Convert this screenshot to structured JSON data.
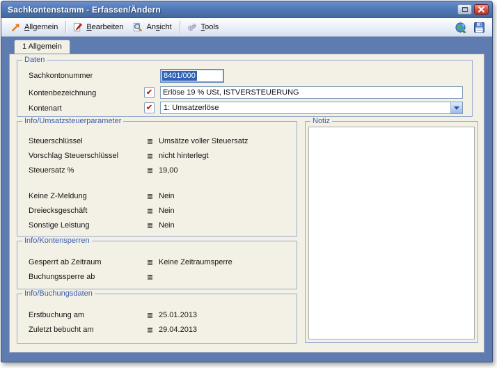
{
  "window": {
    "title": "Sachkontenstamm - Erfassen/Ändern",
    "controls": {
      "restore_icon": "restore-window",
      "close_icon": "close-window"
    }
  },
  "toolbar": {
    "menus": [
      {
        "icon": "arrow-up-right",
        "pre": "",
        "hotkey": "A",
        "post": "llgemein"
      },
      {
        "icon": "edit-page",
        "pre": "",
        "hotkey": "B",
        "post": "earbeiten"
      },
      {
        "icon": "magnifier-page",
        "pre": "An",
        "hotkey": "s",
        "post": "icht"
      },
      {
        "icon": "gears",
        "pre": "",
        "hotkey": "T",
        "post": "ools"
      }
    ],
    "right_icons": [
      "globe",
      "save"
    ]
  },
  "tab": {
    "label": "1 Allgemein"
  },
  "groups": {
    "daten": {
      "title": "Daten",
      "sachkontonummer": {
        "label": "Sachkontonummer",
        "value": "8401/000"
      },
      "kontenbezeichnung": {
        "label": "Kontenbezeichnung",
        "value": "Erlöse 19 % USt, ISTVERSTEUERUNG",
        "check_icon": "red-check"
      },
      "kontenart": {
        "label": "Kontenart",
        "value": "1: Umsatzerlöse",
        "check_icon": "red-check",
        "dropdown_icon": "chevron-down"
      }
    },
    "umsatzsteuer": {
      "title": "Info/Umsatzsteuerparameter",
      "rows": [
        {
          "label": "Steuerschlüssel",
          "value": "Umsätze voller Steuersatz"
        },
        {
          "label": "Vorschlag Steuerschlüssel",
          "value": "nicht hinterlegt"
        },
        {
          "label": "Steuersatz %",
          "value": "19,00"
        },
        {
          "label": "Keine Z-Meldung",
          "value": "Nein"
        },
        {
          "label": "Dreiecksgeschäft",
          "value": "Nein"
        },
        {
          "label": "Sonstige Leistung",
          "value": "Nein"
        }
      ]
    },
    "kontensperren": {
      "title": "Info/Kontensperren",
      "rows": [
        {
          "label": "Gesperrt ab Zeitraum",
          "value": "Keine Zeitraumsperre"
        },
        {
          "label": "Buchungssperre ab",
          "value": ""
        }
      ]
    },
    "buchungsdaten": {
      "title": "Info/Buchungsdaten",
      "rows": [
        {
          "label": "Erstbuchung am",
          "value": "25.01.2013"
        },
        {
          "label": "Zuletzt bebucht am",
          "value": "29.04.2013"
        }
      ]
    },
    "notiz": {
      "title": "Notiz",
      "value": ""
    }
  }
}
